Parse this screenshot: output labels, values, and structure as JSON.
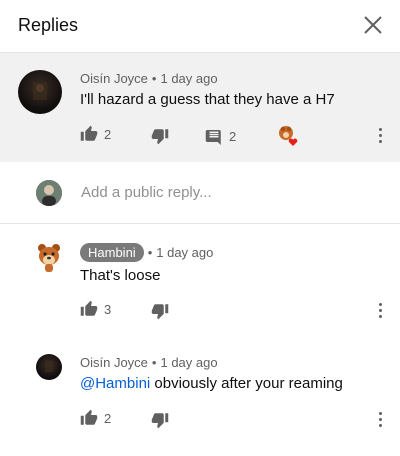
{
  "header": {
    "title": "Replies"
  },
  "reply_box": {
    "placeholder": "Add a public reply..."
  },
  "comments": [
    {
      "author": "Oisín Joyce",
      "time": "1 day ago",
      "text": "I'll hazard a guess that they have a H7",
      "likes": "2",
      "replies": "2"
    },
    {
      "author": "Hambini",
      "time": "1 day ago",
      "text": "That's loose",
      "likes": "3"
    },
    {
      "author": "Oisín Joyce",
      "time": "1 day ago",
      "mention": "@Hambini",
      "text": " obviously after your reaming",
      "likes": "2"
    }
  ],
  "colors": {
    "accent": "#e62117",
    "mention": "#065fd4",
    "highlight": "#f1f1f1"
  }
}
